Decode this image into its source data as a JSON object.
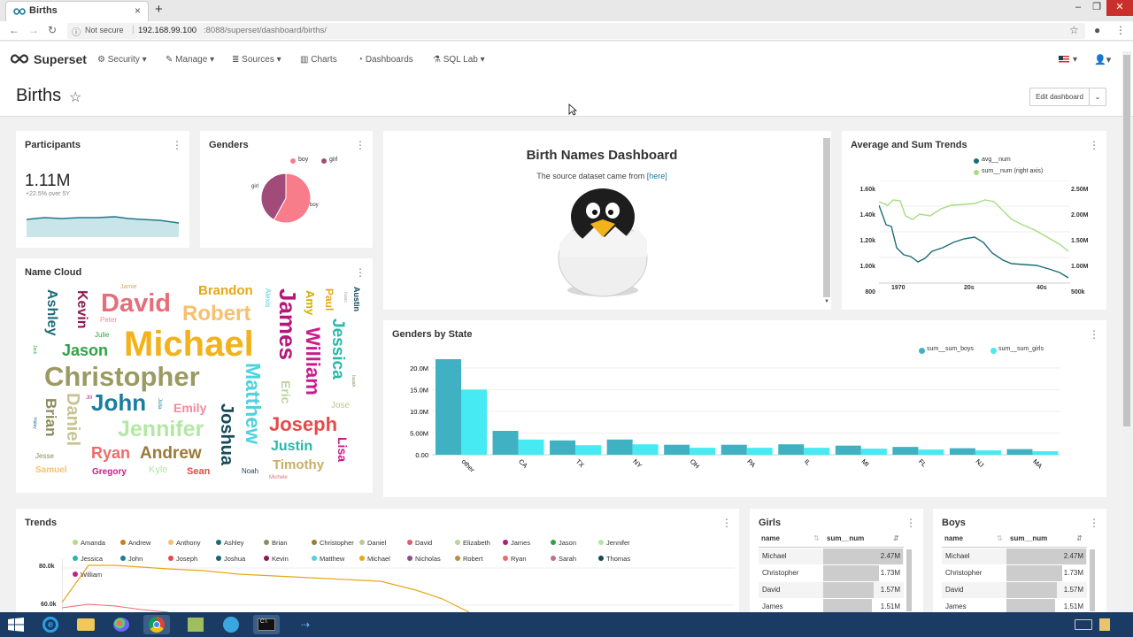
{
  "browser": {
    "tab_title": "Births",
    "tab_close": "×",
    "new_tab": "+",
    "security": "Not secure",
    "url_host": "192.168.99.100",
    "url_path": ":8088/superset/dashboard/births/"
  },
  "navbar": {
    "brand": "Superset",
    "menu": [
      {
        "label": "Security"
      },
      {
        "label": "Manage"
      },
      {
        "label": "Sources"
      },
      {
        "label": "Charts"
      },
      {
        "label": "Dashboards"
      },
      {
        "label": "SQL Lab"
      }
    ]
  },
  "dashboard": {
    "title": "Births",
    "edit_label": "Edit dashboard"
  },
  "participants": {
    "title": "Participants",
    "value": "1.11M",
    "change": "+22.5% over 5Y"
  },
  "genders": {
    "title": "Genders",
    "legend": [
      "boy",
      "girl"
    ],
    "colors": [
      "#f87c8a",
      "#a14b7b"
    ],
    "slices": [
      {
        "label": "boy",
        "share": 0.58
      },
      {
        "label": "girl",
        "share": 0.42
      }
    ]
  },
  "markup": {
    "heading": "Birth Names Dashboard",
    "text": "The source dataset came from",
    "link": "[here]"
  },
  "trends_avg": {
    "title": "Average and Sum Trends",
    "legend": [
      "avg__num",
      "sum__num (right axis)"
    ],
    "left_ticks": [
      "1.60k",
      "1.40k",
      "1.20k",
      "1.00k",
      "800"
    ],
    "right_ticks": [
      "2.50M",
      "2.00M",
      "1.50M",
      "1.00M",
      "500k"
    ],
    "x_ticks": [
      "1970",
      "20s",
      "40s"
    ]
  },
  "name_cloud": {
    "title": "Name Cloud",
    "words": [
      "Michael",
      "Christopher",
      "James",
      "David",
      "Matthew",
      "Robert",
      "John",
      "Joshua",
      "Jennifer",
      "William",
      "Joseph",
      "Daniel",
      "Jessica",
      "Andrew",
      "Brian",
      "Brandon",
      "Jason",
      "Ashley",
      "Kevin",
      "Ryan",
      "Justin",
      "Timothy",
      "Emily",
      "Eric",
      "Amy",
      "Lisa",
      "Paul",
      "Austin",
      "Alexis",
      "Sean",
      "Kyle",
      "Samuel",
      "Gregory",
      "Jesse",
      "Jose",
      "Peter",
      "Julie",
      "Jamie",
      "Noah",
      "Michele",
      "Jill",
      "Julia",
      "Isaac",
      "Isaiah",
      "Jack",
      "Haley"
    ]
  },
  "genders_by_state": {
    "title": "Genders by State",
    "legend": [
      "sum__sum_boys",
      "sum__sum_girls"
    ],
    "yticks": [
      "20.0M",
      "15.0M",
      "10.0M",
      "5.00M",
      "0.00"
    ]
  },
  "chart_data": [
    {
      "type": "bar",
      "title": "Genders by State",
      "categories": [
        "other",
        "CA",
        "TX",
        "NY",
        "OH",
        "PA",
        "IL",
        "MI",
        "FL",
        "NJ",
        "MA"
      ],
      "series": [
        {
          "name": "sum__sum_boys",
          "values": [
            22.0,
            5.5,
            3.3,
            3.5,
            2.3,
            2.3,
            2.4,
            2.1,
            1.8,
            1.5,
            1.3
          ]
        },
        {
          "name": "sum__sum_girls",
          "values": [
            15.0,
            3.5,
            2.2,
            2.4,
            1.6,
            1.6,
            1.6,
            1.4,
            1.2,
            1.0,
            0.8
          ]
        }
      ],
      "ylim": [
        0,
        22
      ]
    }
  ],
  "trends": {
    "title": "Trends",
    "names": [
      "Amanda",
      "Andrew",
      "Anthony",
      "Ashley",
      "Brian",
      "Christopher",
      "Daniel",
      "David",
      "Elizabeth",
      "James",
      "Jason",
      "Jennifer",
      "Jessica",
      "John",
      "Joseph",
      "Joshua",
      "Kevin",
      "Matthew",
      "Michael",
      "Nicholas",
      "Robert",
      "Ryan",
      "Sarah",
      "Thomas",
      "William"
    ],
    "colors": [
      "#b6d886",
      "#c77f1d",
      "#f7c06e",
      "#1f6b78",
      "#8d8a5e",
      "#9a7a38",
      "#c8c394",
      "#e05c6d",
      "#b8d59a",
      "#b5177a",
      "#2fa342",
      "#b3e8a4",
      "#27b8a7",
      "#1b7d9e",
      "#e54a4a",
      "#19637a",
      "#8a1b52",
      "#4fd2df",
      "#e5a818",
      "#8f4b8a",
      "#b98f39",
      "#f06a6a",
      "#c86a91",
      "#154958",
      "#c71d8c"
    ],
    "yticks": [
      "80.0k",
      "60.0k"
    ]
  },
  "girls": {
    "title": "Girls",
    "cols": [
      "name",
      "sum__num"
    ],
    "rows": [
      [
        "Michael",
        "2.47M"
      ],
      [
        "Christopher",
        "1.73M"
      ],
      [
        "David",
        "1.57M"
      ],
      [
        "James",
        "1.51M"
      ]
    ]
  },
  "boys": {
    "title": "Boys",
    "cols": [
      "name",
      "sum__num"
    ],
    "rows": [
      [
        "Michael",
        "2.47M"
      ],
      [
        "Christopher",
        "1.73M"
      ],
      [
        "David",
        "1.57M"
      ],
      [
        "James",
        "1.51M"
      ]
    ]
  }
}
